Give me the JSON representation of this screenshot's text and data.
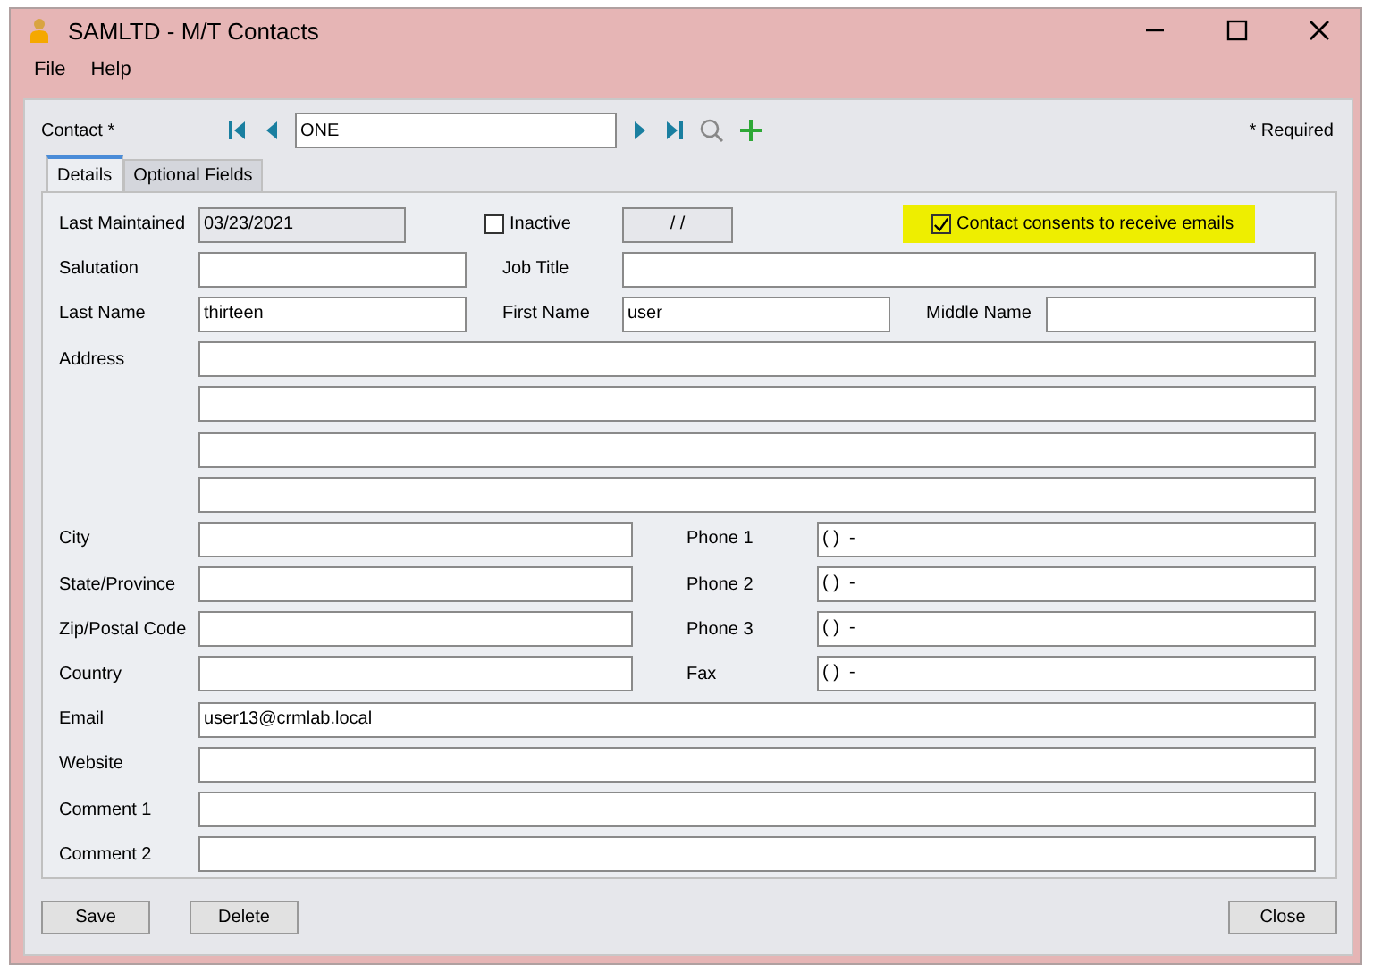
{
  "window": {
    "title": "SAMLTD - M/T Contacts"
  },
  "menu": [
    "File",
    "Help"
  ],
  "toolbar": {
    "label": "Contact *",
    "value": "ONE",
    "required_note": "* Required"
  },
  "tabs": [
    {
      "label": "Details",
      "selected": true
    },
    {
      "label": "Optional Fields",
      "selected": false
    }
  ],
  "form": {
    "last_maintained": {
      "label": "Last Maintained",
      "value": "03/23/2021"
    },
    "inactive": {
      "label": "Inactive",
      "checked": false,
      "date": "/ /"
    },
    "consent": {
      "label": "Contact consents to receive emails",
      "checked": true
    },
    "salutation": {
      "label": "Salutation"
    },
    "job_title": {
      "label": "Job Title"
    },
    "last_name": {
      "label": "Last Name",
      "value": "thirteen"
    },
    "first_name": {
      "label": "First Name",
      "value": "user"
    },
    "middle_name": {
      "label": "Middle Name"
    },
    "address": {
      "label": "Address"
    },
    "left_fields": [
      {
        "label": "City"
      },
      {
        "label": "State/Province"
      },
      {
        "label": "Zip/Postal Code"
      },
      {
        "label": "Country"
      }
    ],
    "right_fields": [
      {
        "label": "Phone 1",
        "value": "( )  -"
      },
      {
        "label": "Phone 2",
        "value": "( )  -"
      },
      {
        "label": "Phone 3",
        "value": "( )  -"
      },
      {
        "label": "Fax",
        "value": "( )  -"
      }
    ],
    "wide_fields": [
      {
        "label": "Email",
        "value": "user13@crmlab.local"
      },
      {
        "label": "Website"
      },
      {
        "label": "Comment 1"
      },
      {
        "label": "Comment 2"
      }
    ]
  },
  "buttons": [
    {
      "label": "Save",
      "kind": "left"
    },
    {
      "label": "Delete",
      "kind": "left"
    },
    {
      "label": "Close",
      "kind": "right"
    }
  ]
}
